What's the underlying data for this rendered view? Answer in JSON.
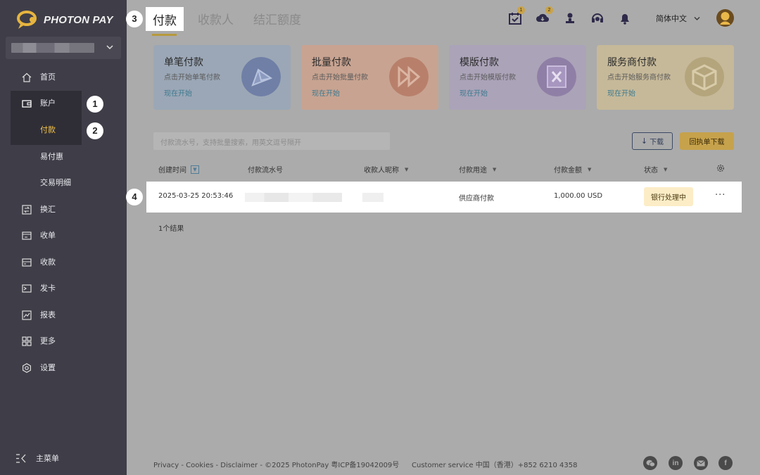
{
  "brand": {
    "name": "PHOTON PAY"
  },
  "sidebar": {
    "items": [
      {
        "label": "首页",
        "icon": "home-icon"
      },
      {
        "label": "账户",
        "icon": "wallet-icon"
      },
      {
        "label": "付款",
        "icon": ""
      },
      {
        "label": "易付惠",
        "icon": ""
      },
      {
        "label": "交易明细",
        "icon": ""
      },
      {
        "label": "换汇",
        "icon": "exchange-icon"
      },
      {
        "label": "收单",
        "icon": "receipt-icon"
      },
      {
        "label": "收款",
        "icon": "card-icon"
      },
      {
        "label": "发卡",
        "icon": "issue-card-icon"
      },
      {
        "label": "报表",
        "icon": "chart-icon"
      },
      {
        "label": "更多",
        "icon": "grid-icon"
      },
      {
        "label": "设置",
        "icon": "gear-icon"
      }
    ],
    "main_menu_label": "主菜单"
  },
  "markers": {
    "m1": "1",
    "m2": "2",
    "m3": "3",
    "m4": "4"
  },
  "header": {
    "tabs": [
      "付款",
      "收款人",
      "结汇额度"
    ],
    "badges": {
      "tasks": "1",
      "downloads": "2"
    },
    "language": "简体中文"
  },
  "cards": [
    {
      "title": "单笔付款",
      "desc": "点击开始单笔付款",
      "cta": "现在开始"
    },
    {
      "title": "批量付款",
      "desc": "点击开始批量付款",
      "cta": "现在开始"
    },
    {
      "title": "模版付款",
      "desc": "点击开始模版付款",
      "cta": "现在开始"
    },
    {
      "title": "服务商付款",
      "desc": "点击开始服务商付款",
      "cta": "现在开始"
    }
  ],
  "toolbar": {
    "search_placeholder": "付款流水号，支持批量搜索，用英文逗号隔开",
    "download_label": "下载",
    "receipt_download_label": "回执单下载"
  },
  "table": {
    "columns": [
      "创建时间",
      "付款流水号",
      "收款人昵称",
      "付款用途",
      "付款金额",
      "状态"
    ],
    "rows": [
      {
        "created": "2025-03-25 20:53:46",
        "purpose": "供应商付款",
        "amount": "1,000.00 USD",
        "status": "银行处理中",
        "more": "···"
      }
    ],
    "result_count": "1个结果"
  },
  "footer": {
    "legal": "Privacy - Cookies - Disclaimer - ©2025 PhotonPay 粤ICP备19042009号",
    "customer_service": "Customer service 中国（香港）+852 6210 4358",
    "social": [
      "wechat-icon",
      "linkedin-icon",
      "mail-icon",
      "facebook-icon"
    ]
  },
  "colors": {
    "sidebar_bg": "#3f3e48",
    "accent_gold": "#c6a24c",
    "active_text": "#f2c24c"
  }
}
